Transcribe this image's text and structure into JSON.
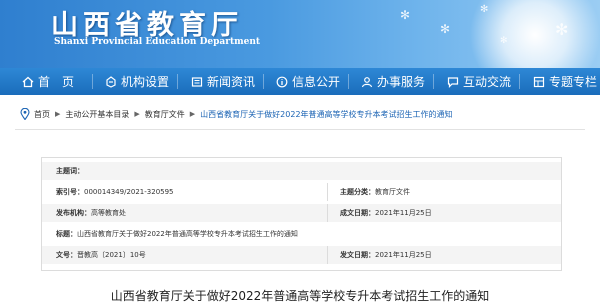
{
  "site": {
    "name": "山西省教育厅",
    "name_en": "Shanxi Provincial Education Department"
  },
  "nav": [
    {
      "label": "首　页",
      "icon": "home-icon"
    },
    {
      "label": "机构设置",
      "icon": "org-icon"
    },
    {
      "label": "新闻资讯",
      "icon": "news-icon"
    },
    {
      "label": "信息公开",
      "icon": "info-icon"
    },
    {
      "label": "办事服务",
      "icon": "service-icon"
    },
    {
      "label": "互动交流",
      "icon": "chat-icon"
    },
    {
      "label": "专题专栏",
      "icon": "topic-icon"
    }
  ],
  "breadcrumb": {
    "icon": "location-pin-icon",
    "items": [
      "首页",
      "主动公开基本目录",
      "教育厅文件",
      "山西省教育厅关于做好2022年普通高等学校专升本考试招生工作的通知"
    ]
  },
  "meta": {
    "topic": {
      "label": "主题词：",
      "value": ""
    },
    "index_no": {
      "label": "索引号：",
      "value": "000014349/2021-320595"
    },
    "category": {
      "label": "主题分类：",
      "value": "教育厅文件"
    },
    "publisher": {
      "label": "发布机构：",
      "value": "高等教育处"
    },
    "created": {
      "label": "成文日期：",
      "value": "2021年11月25日"
    },
    "title": {
      "label": "标题：",
      "value": "山西省教育厅关于做好2022年普通高等学校专升本考试招生工作的通知"
    },
    "doc_no": {
      "label": "文号：",
      "value": "晋教高〔2021〕10号"
    },
    "published": {
      "label": "发文日期：",
      "value": "2021年11月25日"
    }
  },
  "article": {
    "title": "山西省教育厅关于做好2022年普通高等学校专升本考试招生工作的通知"
  },
  "colors": {
    "nav_bg": "#1a6cbb",
    "banner_bg": "#4a9ae0",
    "link": "#1c64b4"
  }
}
